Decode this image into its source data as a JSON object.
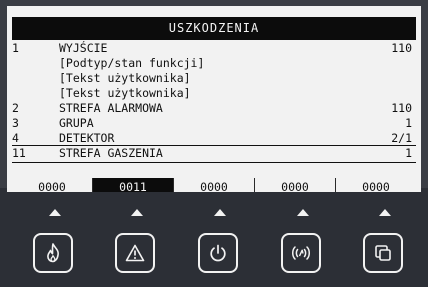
{
  "header": {
    "title": "USZKODZENIA"
  },
  "rows": [
    {
      "num": "1",
      "label": "WYJŚCIE",
      "value": "110"
    },
    {
      "num": "",
      "label": "[Podtyp/stan funkcji]",
      "value": ""
    },
    {
      "num": "",
      "label": "[Tekst użytkownika]",
      "value": ""
    },
    {
      "num": "",
      "label": "[Tekst użytkownika]",
      "value": ""
    },
    {
      "num": "2",
      "label": "STREFA ALARMOWA",
      "value": "110"
    },
    {
      "num": "3",
      "label": "GRUPA",
      "value": "1"
    },
    {
      "num": "4",
      "label": "DETEKTOR",
      "value": "2/1"
    },
    {
      "num": "11",
      "label": "STREFA GASZENIA",
      "value": "1"
    }
  ],
  "tabs": [
    {
      "label": "0000",
      "active": false
    },
    {
      "label": "0011",
      "active": true
    },
    {
      "label": "0000",
      "active": false
    },
    {
      "label": "0000",
      "active": false
    },
    {
      "label": "0000",
      "active": false
    }
  ],
  "keys": [
    {
      "icon": "flame-icon"
    },
    {
      "icon": "warning-triangle-icon"
    },
    {
      "icon": "power-icon"
    },
    {
      "icon": "sounder-signal-icon"
    },
    {
      "icon": "copy-windows-icon"
    }
  ],
  "colors": {
    "bezel": "#2c2f36",
    "screen": "#f2f2f2",
    "ink": "#0c0c0c",
    "icon": "#f2f2f2"
  }
}
